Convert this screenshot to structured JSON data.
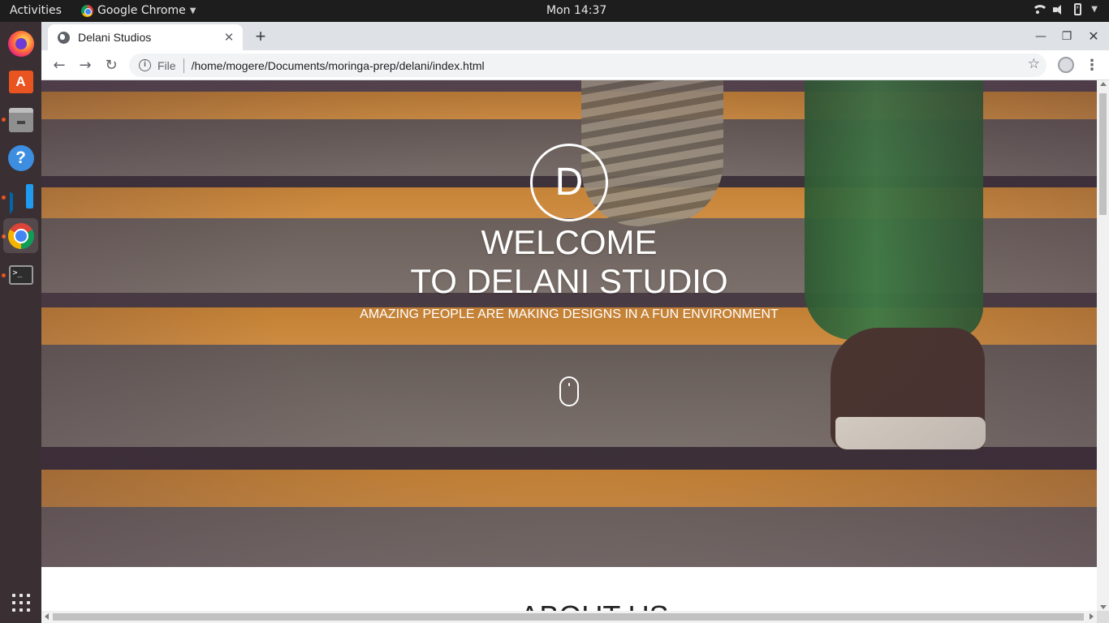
{
  "topbar": {
    "activities": "Activities",
    "app_name": "Google Chrome",
    "clock": "Mon 14:37"
  },
  "dock": {
    "items": [
      {
        "name": "firefox",
        "icon": "firefox-icon"
      },
      {
        "name": "ubuntu-software",
        "icon": "software-center-icon"
      },
      {
        "name": "files",
        "icon": "files-icon"
      },
      {
        "name": "help",
        "icon": "help-icon"
      },
      {
        "name": "vscode",
        "icon": "vscode-icon"
      },
      {
        "name": "chrome",
        "icon": "chrome-icon",
        "active": true
      },
      {
        "name": "terminal",
        "icon": "terminal-icon"
      },
      {
        "name": "show-applications",
        "icon": "app-grid-icon"
      }
    ],
    "terminal_glyph": ">_"
  },
  "browser": {
    "tab_title": "Delani Studios",
    "url_scheme": "File",
    "url": "/home/mogere/Documents/moringa-prep/delani/index.html"
  },
  "page": {
    "logo_letter": "D",
    "welcome_line1": "WELCOME",
    "welcome_line2": "TO DELANI STUDIO",
    "tagline": "AMAZING PEOPLE ARE MAKING DESIGNS IN A FUN ENVIRONMENT",
    "about_title": "ABOUT US"
  },
  "colors": {
    "accent_orange": "#f3a540",
    "ubuntu_orange": "#e95420",
    "dock_bg": "#3a2f33",
    "topbar_bg": "#1d1d1d"
  }
}
